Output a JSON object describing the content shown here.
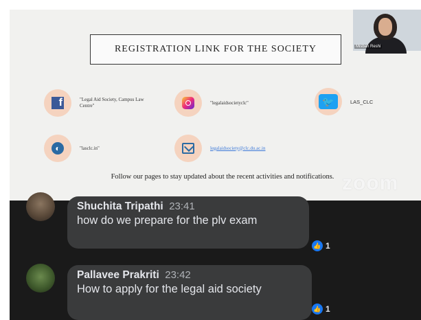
{
  "slide": {
    "title": "REGISTRATION LINK FOR THE SOCIETY",
    "participant_name": "Misbah Reshi",
    "socials": [
      {
        "icon": "facebook-icon",
        "label": "\"Legal Aid Society, Campus Law Centre\""
      },
      {
        "icon": "instagram-icon",
        "label": "\"legalaidsocietyclc\""
      },
      {
        "icon": "twitter-icon",
        "label": "LAS_CLC"
      },
      {
        "icon": "globe-icon",
        "label": "\"lasclc.in\""
      },
      {
        "icon": "mail-icon",
        "label": "legalaidsociety@clc.du.ac.in"
      }
    ],
    "follow_text": "Follow our pages to stay updated about the recent activities and notifications.",
    "watermark": "zoom"
  },
  "comments": [
    {
      "name": "Shuchita Tripathi",
      "time": "23:41",
      "message": "how do we prepare for the plv exam",
      "likes": "1"
    },
    {
      "name": "Pallavee Prakriti",
      "time": "23:42",
      "message": "How to apply for the legal aid society",
      "likes": "1"
    }
  ],
  "colors": {
    "like": "#1877f2",
    "bubble": "#3a3b3c",
    "social_circle": "#f5d3bf"
  }
}
